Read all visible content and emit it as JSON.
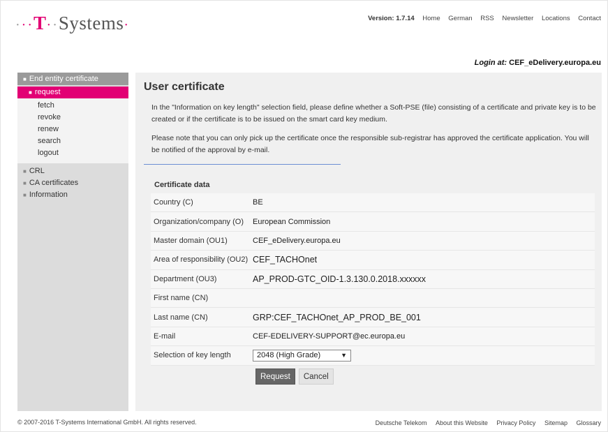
{
  "header": {
    "logo_text": "Systems",
    "logo_t": "T",
    "version": "Version: 1.7.14",
    "nav": [
      "Home",
      "German",
      "RSS",
      "Newsletter",
      "Locations",
      "Contact"
    ],
    "login_label": "Login at:",
    "login_value": "CEF_eDelivery.europa.eu"
  },
  "sidebar": {
    "section_title": "End entity certificate",
    "active_item": "request",
    "sub_items": [
      "fetch",
      "revoke",
      "renew",
      "search",
      "logout"
    ],
    "main_items": [
      "CRL",
      "CA certificates",
      "Information"
    ]
  },
  "main": {
    "title": "User certificate",
    "paragraph1": "In the \"Information on key length\" selection field, please define whether a Soft-PSE (file) consisting of a certificate and private key is to be created or if the certificate is to be issued on the smart card key medium.",
    "paragraph2": "Please note that you can only pick up the certificate once the responsible sub-registrar has approved the certificate application. You will be notified of the approval by e-mail.",
    "form_title": "Certificate data",
    "fields": [
      {
        "label": "Country (C)",
        "value": "BE"
      },
      {
        "label": "Organization/company (O)",
        "value": "European Commission"
      },
      {
        "label": "Master domain (OU1)",
        "value": "CEF_eDelivery.europa.eu"
      },
      {
        "label": "Area of responsibility (OU2)",
        "value": "CEF_TACHOnet"
      },
      {
        "label": "Department (OU3)",
        "value": "AP_PROD-GTC_OID-1.3.130.0.2018.xxxxxx"
      },
      {
        "label": "First name (CN)",
        "value": ""
      },
      {
        "label": "Last name (CN)",
        "value": "GRP:CEF_TACHOnet_AP_PROD_BE_001"
      },
      {
        "label": "E-mail",
        "value": "CEF-EDELIVERY-SUPPORT@ec.europa.eu"
      },
      {
        "label": "Selection of key length",
        "value": "2048 (High Grade)"
      }
    ],
    "request_label": "Request",
    "cancel_label": "Cancel"
  },
  "footer": {
    "copyright": "© 2007-2016 T-Systems International GmbH. All rights reserved.",
    "links": [
      "Deutsche Telekom",
      "About this Website",
      "Privacy Policy",
      "Sitemap",
      "Glossary"
    ]
  }
}
